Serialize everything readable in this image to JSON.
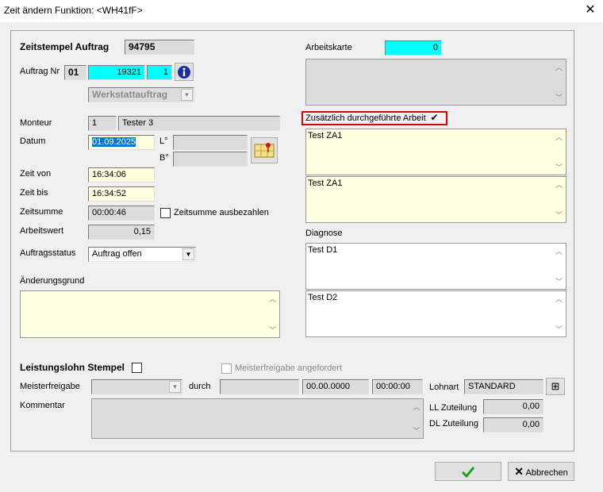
{
  "window": {
    "title": "Zeit ändern   Funktion: <WH41fF>",
    "close_glyph": "✕"
  },
  "zeitstempel": {
    "label": "Zeitstempel Auftrag",
    "value": "94795"
  },
  "auftrag": {
    "label": "Auftrag Nr",
    "prefix": "01",
    "number": "19321",
    "sub": "1",
    "type": "Werkstattauftrag"
  },
  "monteur": {
    "label": "Monteur",
    "id": "1",
    "name": "Tester 3"
  },
  "datum": {
    "label": "Datum",
    "value": "01.09.2025",
    "l_label": "L°",
    "b_label": "B°"
  },
  "zeit_von": {
    "label": "Zeit von",
    "value": "16:34:06"
  },
  "zeit_bis": {
    "label": "Zeit bis",
    "value": "16:34:52"
  },
  "zeitsumme": {
    "label": "Zeitsumme",
    "value": "00:00:46",
    "checkbox_label": "Zeitsumme ausbezahlen"
  },
  "arbeitswert": {
    "label": "Arbeitswert",
    "value": "0,15"
  },
  "auftragsstatus": {
    "label": "Auftragsstatus",
    "value": "Auftrag offen"
  },
  "aenderungsgrund": {
    "label": "Änderungsgrund"
  },
  "arbeitskarte": {
    "label": "Arbeitskarte",
    "value": "0"
  },
  "zusatz": {
    "label": "Zusätzlich durchgeführte Arbeit",
    "text1": "Test ZA1",
    "text2": "Test ZA1"
  },
  "diagnose": {
    "label": "Diagnose",
    "text1": "Test D1",
    "text2": "Test D2"
  },
  "leistungslohn": {
    "label": "Leistungslohn Stempel",
    "meister_angefordert_label": "Meisterfreigabe angefordert",
    "meisterfreigabe_label": "Meisterfreigabe",
    "durch_label": "durch",
    "date_value": "00.00.0000",
    "time_value": "00:00:00",
    "kommentar_label": "Kommentar"
  },
  "lohnart": {
    "label": "Lohnart",
    "value": "STANDARD"
  },
  "ll_zuteilung": {
    "label": "LL Zuteilung",
    "value": "0,00"
  },
  "dl_zuteilung": {
    "label": "DL Zuteilung",
    "value": "0,00"
  },
  "buttons": {
    "cancel_label": "Abbrechen"
  },
  "colors": {
    "cyan": "#00ffff",
    "note_yellow": "#ffffe1",
    "highlight_red": "#e00000"
  }
}
